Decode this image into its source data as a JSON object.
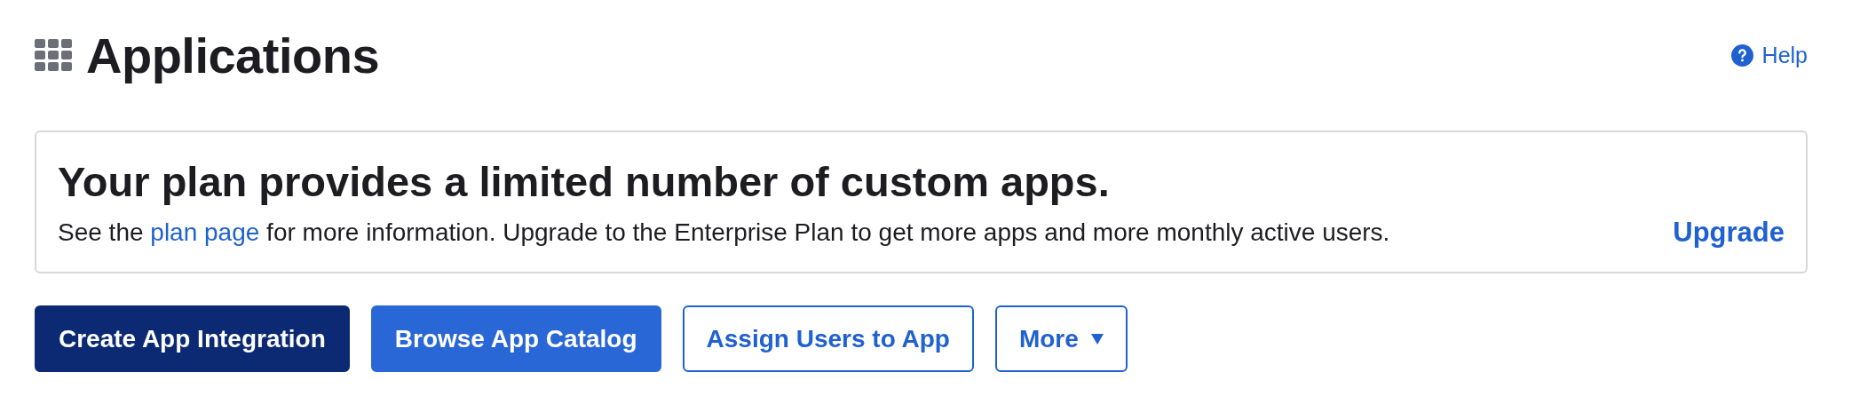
{
  "header": {
    "title": "Applications",
    "help": "Help"
  },
  "banner": {
    "heading": "Your plan provides a limited number of custom apps.",
    "text_before": "See the ",
    "link": "plan page",
    "text_after": " for more information. Upgrade to the Enterprise Plan to get more apps and more monthly active users.",
    "action": "Upgrade"
  },
  "buttons": [
    {
      "label": "Create App Integration",
      "kind": "dark"
    },
    {
      "label": "Browse App Catalog",
      "kind": "primary"
    },
    {
      "label": "Assign Users to App",
      "kind": "outline"
    },
    {
      "label": "More",
      "kind": "dropdown"
    }
  ]
}
